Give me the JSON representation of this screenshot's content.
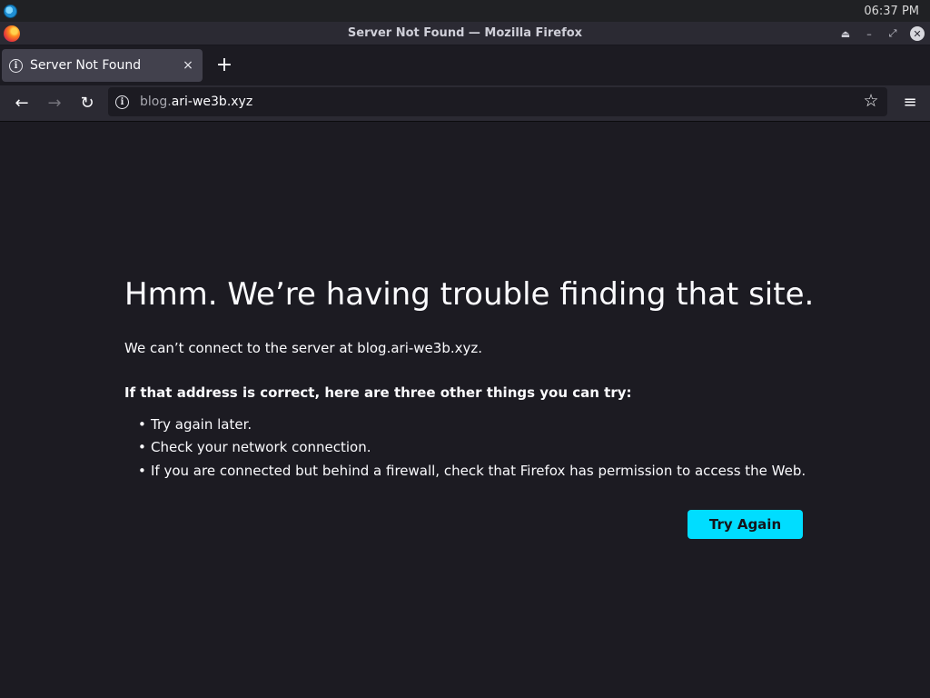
{
  "system": {
    "clock": "06:37 PM"
  },
  "window": {
    "title": "Server Not Found — Mozilla Firefox",
    "controls": {
      "keep_above": "⏏",
      "minimize": "–",
      "restore": "⤢",
      "close": "✕"
    }
  },
  "tabs": [
    {
      "label": "Server Not Found",
      "close_glyph": "×",
      "icon": "info-icon"
    }
  ],
  "new_tab_glyph": "+",
  "toolbar": {
    "back_glyph": "←",
    "forward_glyph": "→",
    "reload_glyph": "↻",
    "url_subdomain": "blog.",
    "url_domain": "ari-we3b.xyz",
    "bookmark_glyph": "☆",
    "menu_glyph": "≡"
  },
  "error_page": {
    "title": "Hmm. We’re having trouble finding that site.",
    "description": "We can’t connect to the server at blog.ari-we3b.xyz.",
    "suggestions_heading": "If that address is correct, here are three other things you can try:",
    "suggestions": [
      "Try again later.",
      "Check your network connection.",
      "If you are connected but behind a firewall, check that Firefox has permission to access the Web."
    ],
    "try_again_label": "Try Again"
  },
  "colors": {
    "page_bg": "#1c1b22",
    "accent_button": "#00ddff",
    "text": "#fbfbfe"
  }
}
